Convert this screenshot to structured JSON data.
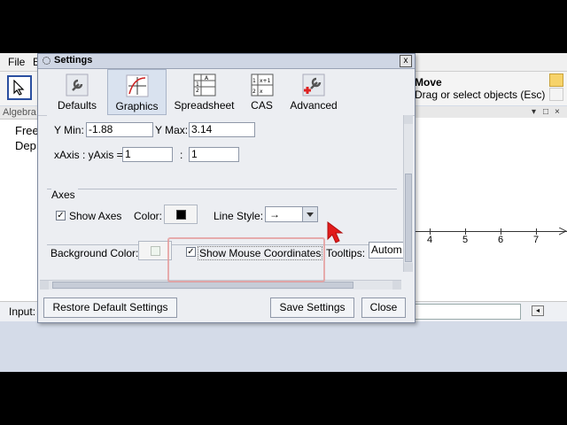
{
  "app": {
    "menu": [
      "File",
      "E"
    ],
    "algebra_header": "Algebra",
    "algebra_items": [
      "Free",
      "Dep"
    ],
    "mode_title": "Move",
    "mode_hint": "Drag or select objects (Esc)",
    "x_axis_ticks": [
      "4",
      "5",
      "6",
      "7"
    ],
    "input_label": "Input:"
  },
  "dialog": {
    "title": "Settings",
    "close_symbol": "x",
    "tabs": [
      {
        "label": "Defaults",
        "icon": "wrench-icon"
      },
      {
        "label": "Graphics",
        "icon": "graph-icon"
      },
      {
        "label": "Spreadsheet",
        "icon": "spreadsheet-icon"
      },
      {
        "label": "CAS",
        "icon": "cas-icon"
      },
      {
        "label": "Advanced",
        "icon": "advanced-icon"
      }
    ],
    "active_tab": "Graphics",
    "ymin_label": "Y Min:",
    "ymin_value": "-1.88",
    "ymax_label": "Y Max:",
    "ymax_value": "3.14",
    "ratio_label": "xAxis : yAxis =",
    "ratio_x": "1",
    "ratio_sep": ":",
    "ratio_y": "1",
    "axes_group_label": "Axes",
    "show_axes_label": "Show Axes",
    "show_axes_checked": true,
    "color_label": "Color:",
    "axes_color": "#000000",
    "line_style_label": "Line Style:",
    "line_style_value": "→",
    "background_color_label": "Background Color:",
    "background_color": "#eef5ee",
    "show_mouse_coords_label": "Show Mouse Coordinates",
    "show_mouse_coords_checked": true,
    "tooltips_label": "Tooltips:",
    "tooltips_value": "Autom",
    "restore_button": "Restore Default Settings",
    "save_button": "Save Settings",
    "close_button": "Close"
  }
}
